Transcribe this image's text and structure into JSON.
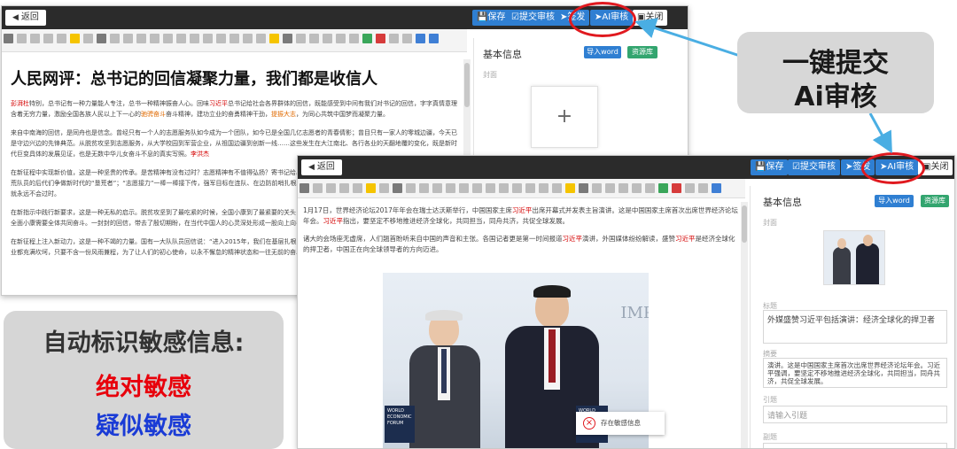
{
  "window_back": {
    "back_label": "返回",
    "save_label": "保存",
    "submit_review_label": "提交审核",
    "send_label": "签发",
    "ai_review_label": "AI审核",
    "close_label": "关闭",
    "article_title": "人民网评：总书记的回信凝聚力量，我们都是收信人",
    "paragraphs": [
      [
        "彭湃杜",
        "特别，总书记有一种力量能人专注，总书一种精神振奋人心。回味",
        "习近平",
        "总书记给社会各界群体的回信，既能感受到中间有我们对书记的回信，字字真情意理含着无穷力量，激励全国各族人民以上下一心的",
        "驰骋奋斗",
        "奋斗精神，建功立业的奋勇精神干劲，",
        "提振大志",
        "，为同心共筑中国梦而凝聚力量。"
      ],
      [
        "来自中南海的回信，是同舟也是信念。曾经只有一个人的志愿服务队如今成为一个团队，如今已是全国几亿志愿者的青春倩影；曾目只有一家人的零城边疆，今天已是守边兴边的先锋典范。从脱贫攻坚到志愿服务，从大学校园到军营企业，从祖国边疆到创新一线……这些发生在大江南北、各行各业的天翻地覆的变化，既是新时代巨变具体的发展见证，也是无数中华儿女奋斗不息的真实写照。",
        "李洪杰",
        ""
      ],
      [
        "在新征程中实现新价值，这是一种坚贵的传承。是苦精神有没有过时？志愿精神有不值得弘扬？寄书记给出了铿锵有力的答案。在新征途的鞭策下，浙江大陈岛老垦荒队员的后代们争做新时代的“垦荒者”；“志愿接力”一棒一棒接下传，强军目标在连队、在边防前哨扎根。事实证明，只要抓紧落实，各项工作都能统一，这一精神就永远不会过时。"
      ],
      [
        "在新指示中践行新要求，这是一种无私的启示。脱贫攻坚到了最吃紧的时候，全国小康到了最紧要的关头，各地奋进的号角已经吹响。伟大梦想需要全国上下同心，全面小康需要全体共同奋斗。一封封的回信，带去了殷切期盼，在当代中国人的心灵深处形成一股向上向善的力量……"
      ],
      [
        "在新征程上注入新动力，这是一种不竭的力量。国有一大队队员回信说：“进入2015年，我们在基层扎根，我们接到总书记回信，大伙儿劲一下子就起来了。”任何事业都充满坎坷，只要不含一份风雨兼程，为了让人们的初心使命，以永不懈怠的精神状态和一往无前的奋斗姿态继续前行……"
      ]
    ],
    "panel_title": "基本信息",
    "import_word_label": "导入word",
    "resource_library_label": "资源库",
    "cover_label": "封面",
    "add_symbol": "+"
  },
  "window_front": {
    "back_label": "返回",
    "save_label": "保存",
    "submit_review_label": "提交审核",
    "send_label": "签发",
    "ai_review_label": "AI审核",
    "close_label": "关闭",
    "paragraph_1_pre": "1月17日，世界经济论坛2017年年会在瑞士达沃斯举行，中国国家主席",
    "paragraph_1_name": "习近平",
    "paragraph_1_post": "出席开幕式并发表主旨演讲。这是中国国家主席首次出席世界经济论坛年会。",
    "paragraph_1_name2": "习近平",
    "paragraph_1_tail": "指出，要坚定不移地推进经济全球化，共同担当，同舟共济，共促全球发展。",
    "paragraph_2_pre": "诸大的会场座无虚席，人们翘首盼听来自中国的声音和主张。各国记者更是第一时间报道",
    "paragraph_2_name": "习近平",
    "paragraph_2_mid": "演讲，外国媒体纷纷解读，盛赞",
    "paragraph_2_name2": "习近平",
    "paragraph_2_post": "是经济全球化的捍卫者，中国正在向全球领导者的方向迈进。",
    "photo_text_imp": "IMP",
    "photo_text_forum_left": "WORLD\nECONOMIC\nFORUM",
    "photo_text_forum_right": "WORLD\nECONOMIC\nFORUM",
    "sensitive_popup_text": "存在敏感信息",
    "panel_title": "基本信息",
    "import_word_label": "导入word",
    "resource_library_label": "资源库",
    "cover_label": "封面",
    "title_label": "标题",
    "title_value": "外媒盛赞习近平包括演讲：经济全球化的捍卫者",
    "summary_label": "摘要",
    "summary_value": "演讲。这是中国国家主席首次出席世界经济论坛年会。习近平强调，要坚定不移地推进经济全球化，共同担当，同舟共济，共促全球发展。",
    "lead_label": "引题",
    "lead_placeholder": "请输入引题",
    "sub_label": "副题"
  },
  "callout_top_right": {
    "line1": "一键提交",
    "line2": "Ai审核"
  },
  "callout_bottom_left": {
    "line1": "自动标识敏感信息:",
    "line2": "绝对敏感",
    "line3": "疑似敏感"
  },
  "colors": {
    "topbar": "#2b2b2b",
    "accent_blue": "#2f7fd2",
    "accent_green": "#33a56f",
    "highlight_red": "#e0191f",
    "callout_red": "#e8000b",
    "callout_blue": "#1a3bd6",
    "arrow_blue": "#4aaee3"
  }
}
